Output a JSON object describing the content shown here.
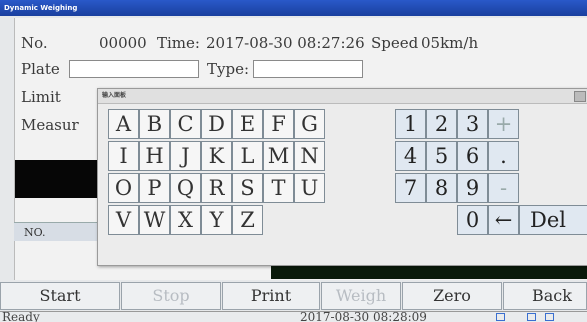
{
  "window": {
    "title": "Dynamic Weighing"
  },
  "form": {
    "no_label": "No.",
    "no_value": "00000",
    "time_label": "Time:",
    "time_value": "2017-08-30 08:27:26",
    "speed_label": "Speed",
    "speed_value": "05km/h",
    "plate_label": "Plate",
    "type_label": "Type:",
    "limit_label": "Limit",
    "measure_label": "Measur"
  },
  "table": {
    "col_no": "NO."
  },
  "keyboard": {
    "title": "输入面板",
    "letters_row1": [
      "A",
      "B",
      "C",
      "D",
      "E",
      "F",
      "G"
    ],
    "letters_row2": [
      "I",
      "H",
      "J",
      "K",
      "L",
      "M",
      "N"
    ],
    "letters_row3": [
      "O",
      "P",
      "Q",
      "R",
      "S",
      "T",
      "U"
    ],
    "letters_row4": [
      "V",
      "W",
      "X",
      "Y",
      "Z"
    ],
    "nums_row1": [
      "1",
      "2",
      "3",
      "+"
    ],
    "nums_row2": [
      "4",
      "5",
      "6",
      "."
    ],
    "nums_row3": [
      "7",
      "8",
      "9",
      "-"
    ],
    "zero": "0",
    "backspace": "←",
    "delete": "Del"
  },
  "buttons": {
    "start": "Start",
    "stop": "Stop",
    "print": "Print",
    "weigh": "Weigh",
    "zero": "Zero",
    "back": "Back"
  },
  "status": {
    "left": "Ready",
    "time": "2017-08-30 08:28:09"
  }
}
